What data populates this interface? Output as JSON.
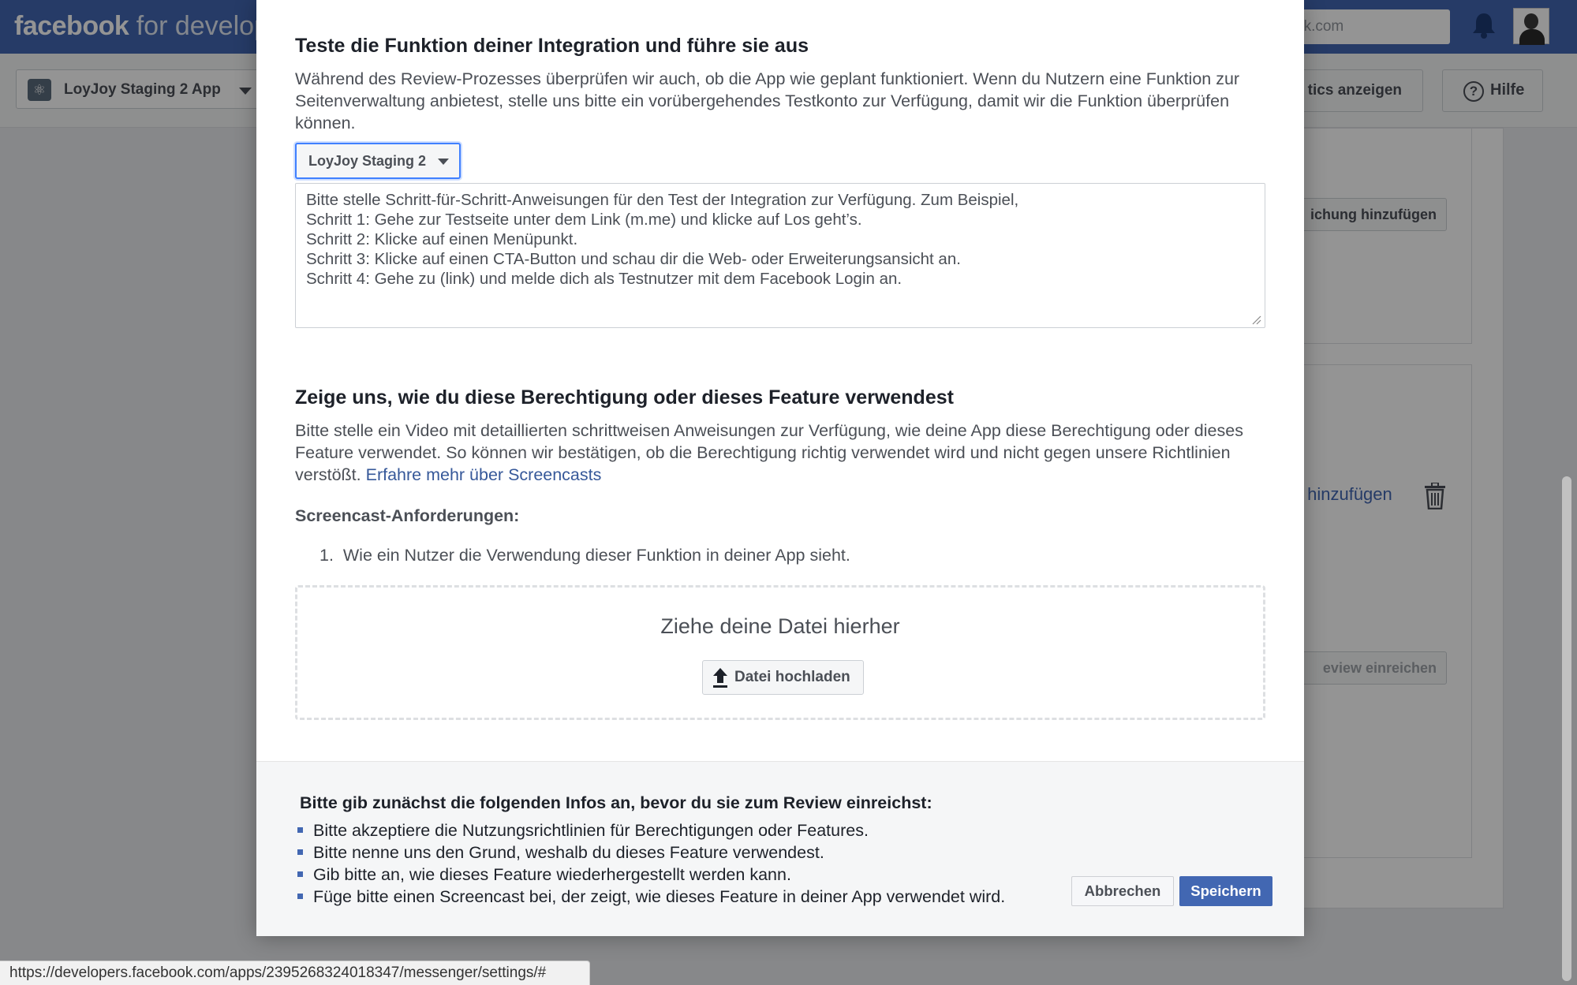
{
  "background": {
    "brand_bold": "facebook",
    "brand_light": " for developer",
    "search_partial": "ok.com",
    "app_selector": "LoyJoy Staging 2 App",
    "analytics_button": "tics anzeigen",
    "help_button": "Hilfe",
    "partial_button_1": "ichung hinzufügen",
    "partial_link": "s hinzufügen",
    "partial_button_2": "eview einreichen"
  },
  "modal": {
    "test_section": {
      "title": "Teste die Funktion deiner Integration und führe sie aus",
      "description": "Während des Review-Prozesses überprüfen wir auch, ob die App wie geplant funktioniert. Wenn du Nutzern eine Funktion zur Seitenverwaltung anbietest, stelle uns bitte ein vorübergehendes Testkonto zur Verfügung, damit wir die Funktion überprüfen können.",
      "page_selector": "LoyJoy Staging 2",
      "instructions_placeholder": "Bitte stelle Schritt-für-Schritt-Anweisungen für den Test der Integration zur Verfügung. Zum Beispiel,\nSchritt 1: Gehe zur Testseite unter dem Link (m.me) und klicke auf Los geht’s.\nSchritt 2: Klicke auf einen Menüpunkt.\nSchritt 3: Klicke auf einen CTA-Button und schau dir die Web- oder Erweiterungsansicht an.\nSchritt 4: Gehe zu (link) und melde dich als Testnutzer mit dem Facebook Login an."
    },
    "screencast_section": {
      "title": "Zeige uns, wie du diese Berechtigung oder dieses Feature verwendest",
      "description": "Bitte stelle ein Video mit detaillierten schrittweisen Anweisungen zur Verfügung, wie deine App diese Berechtigung oder dieses Feature verwendet. So können wir bestätigen, ob die Berechtigung richtig verwendet wird und nicht gegen unsere Richtlinien verstößt.",
      "learn_more_link": "Erfahre mehr über Screencasts",
      "requirements_title": "Screencast-Anforderungen:",
      "requirements": [
        "1.  Wie ein Nutzer die Verwendung dieser Funktion in deiner App sieht."
      ],
      "dropzone_title": "Ziehe deine Datei hierher",
      "upload_button": "Datei hochladen"
    },
    "footer": {
      "title": "Bitte gib zunächst die folgenden Infos an, bevor du sie zum Review einreichst:",
      "items": [
        "Bitte akzeptiere die Nutzungsrichtlinien für Berechtigungen oder Features.",
        "Bitte nenne uns den Grund, weshalb du dieses Feature verwendest.",
        "Gib bitte an, wie dieses Feature wiederhergestellt werden kann.",
        "Füge bitte einen Screencast bei, der zeigt, wie dieses Feature in deiner App verwendet wird."
      ],
      "cancel_button": "Abbrechen",
      "save_button": "Speichern"
    }
  },
  "status_bar_url": "https://developers.facebook.com/apps/2395268324018347/messenger/settings/#",
  "icons": {
    "notifications": "bell-icon",
    "app": "atom-icon",
    "help": "question-circle-icon",
    "delete": "trash-icon",
    "upload": "upload-arrow-icon",
    "dropdown": "caret-down-icon"
  },
  "colors": {
    "brand_blue": "#4267b2",
    "link_blue": "#365899",
    "focus_blue": "#4080ff",
    "text_dark": "#1d2129",
    "text_muted": "#4b4f56"
  }
}
